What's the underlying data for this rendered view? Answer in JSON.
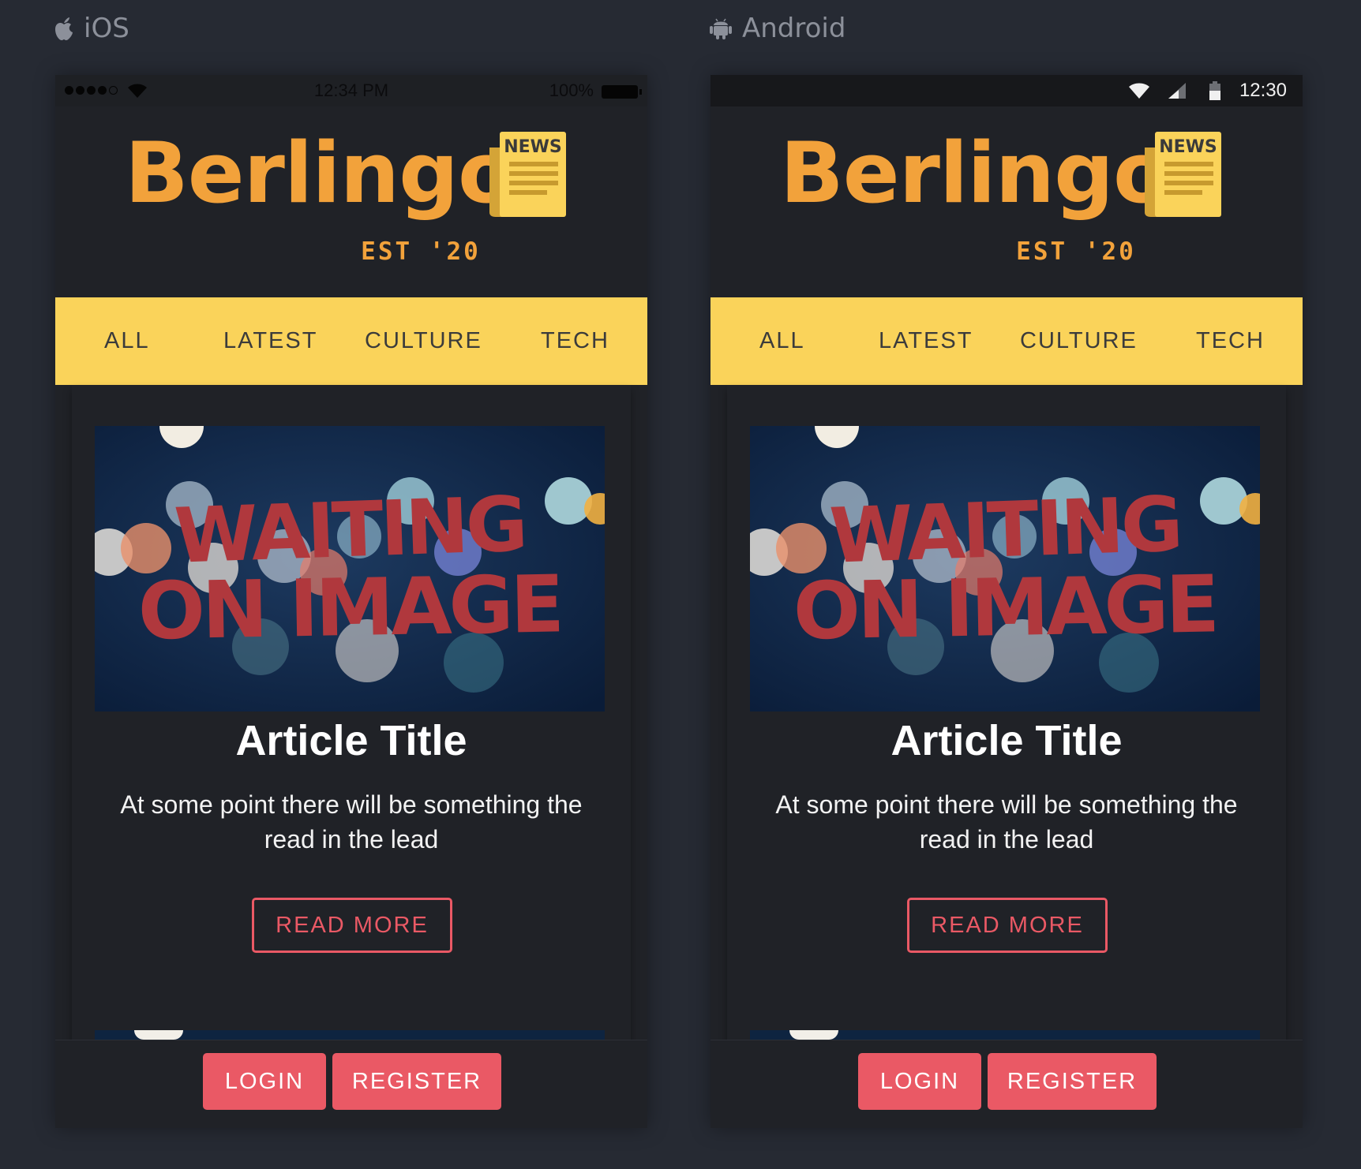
{
  "platforms": {
    "ios": {
      "label": "iOS"
    },
    "android": {
      "label": "Android"
    }
  },
  "status": {
    "ios": {
      "time": "12:34 PM",
      "battery": "100%"
    },
    "android": {
      "time": "12:30"
    }
  },
  "logo": {
    "word": "Berlingo",
    "badge": "NEWS",
    "est": "EST '20"
  },
  "nav": {
    "items": [
      "ALL",
      "LATEST",
      "CULTURE",
      "TECH"
    ]
  },
  "article": {
    "image_text_line1": "WAITING",
    "image_text_line2": "ON IMAGE",
    "title": "Article Title",
    "lead": "At some point there will be something the read in the lead",
    "read_more": "READ MORE"
  },
  "auth": {
    "login": "LOGIN",
    "register": "REGISTER"
  },
  "colors": {
    "background": "#262a33",
    "screen": "#202227",
    "logo": "#f2a23b",
    "nav": "#fad35a",
    "accent": "#ea5965"
  },
  "icons": {
    "ios_platform": "apple-icon",
    "android_platform": "android-icon"
  }
}
